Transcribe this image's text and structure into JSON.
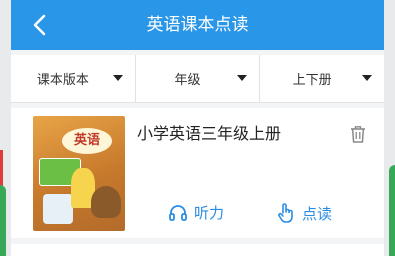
{
  "header": {
    "title": "英语课本点读"
  },
  "filters": [
    {
      "label": "课本版本"
    },
    {
      "label": "年级"
    },
    {
      "label": "上下册"
    }
  ],
  "book": {
    "title": "小学英语三年级上册",
    "cover_title": "英语",
    "actions": {
      "listen": "听力",
      "read": "点读"
    }
  },
  "colors": {
    "header": "#2a96e8",
    "accent": "#2a8de3"
  }
}
